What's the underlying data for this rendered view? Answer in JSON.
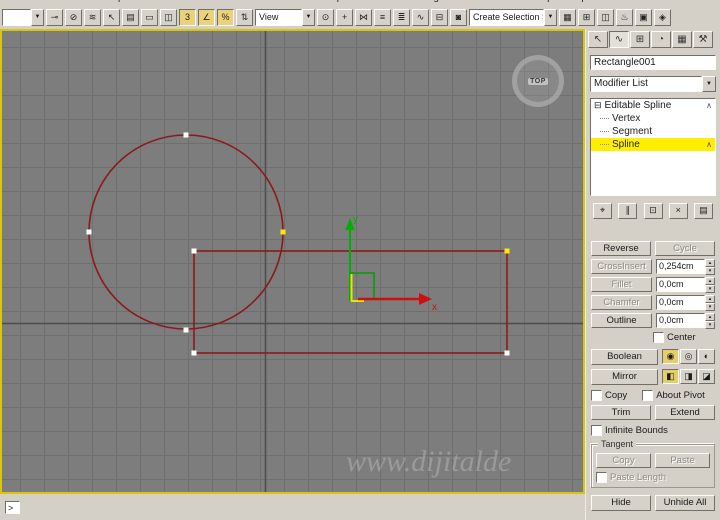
{
  "colors": {
    "ui_gray": "#d4d0c8",
    "viewport_bg": "#7d7d7d",
    "active_viewport_border": "#d8c60a",
    "spline_red": "#8b1a1a",
    "selected_vertex_yellow": "#ffe800",
    "vertex_white": "#ffffff",
    "axis_y_green": "#00b000",
    "axis_x_red": "#cc1010",
    "stack_highlight_yellow": "#ffee00"
  },
  "icons": {
    "combo_arrow": "▼",
    "minus_box": "⊟",
    "chevron": "∧",
    "spin_up": "▴",
    "spin_down": "▾"
  },
  "menu": {
    "items": [
      "File",
      "Edit",
      "Tools",
      "Group",
      "Views",
      "Create",
      "Modifiers",
      "Animation",
      "Graph Editors",
      "Rendering",
      "Customize",
      "MAXScript",
      "Help"
    ]
  },
  "toolbar": {
    "left_combo_value": "",
    "view_combo_value": "View",
    "selection_combo_value": "Create Selection Se",
    "group1": [
      {
        "n": "select-and-link-icon",
        "g": "⊸"
      },
      {
        "n": "unlink-selection-icon",
        "g": "⊘"
      },
      {
        "n": "bind-to-spacewarp-icon",
        "g": "≋"
      },
      {
        "n": "select-object-icon",
        "g": "↖"
      },
      {
        "n": "select-by-name-icon",
        "g": "▤"
      },
      {
        "n": "select-region-icon",
        "g": "▭"
      },
      {
        "n": "window-crossing-icon",
        "g": "◫"
      },
      {
        "n": "snap-toggle-icon",
        "g": "3",
        "cls": "snap"
      },
      {
        "n": "angle-snap-icon",
        "g": "∠",
        "cls": "snap"
      },
      {
        "n": "percent-snap-icon",
        "g": "%",
        "cls": "snap"
      },
      {
        "n": "spinner-snap-icon",
        "g": "⇅"
      }
    ],
    "group2": [
      {
        "n": "use-center-icon",
        "g": "⊙"
      },
      {
        "n": "select-manipulate-icon",
        "g": "+"
      },
      {
        "n": "mirror-tool-icon",
        "g": "⋈"
      },
      {
        "n": "align-tool-icon",
        "g": "≡"
      },
      {
        "n": "layer-manager-icon",
        "g": "≣"
      },
      {
        "n": "curve-editor-icon",
        "g": "∿"
      },
      {
        "n": "schematic-view-icon",
        "g": "⊟"
      },
      {
        "n": "material-editor-icon",
        "g": "◙"
      }
    ],
    "group3": [
      {
        "n": "named-selections-icon",
        "g": "▦"
      },
      {
        "n": "array-tool-icon",
        "g": "⊞"
      },
      {
        "n": "snapshot-icon",
        "g": "◫"
      },
      {
        "n": "render-setup-icon",
        "g": "♨"
      },
      {
        "n": "render-frame-icon",
        "g": "▣"
      },
      {
        "n": "quick-render-icon",
        "g": "◈"
      }
    ]
  },
  "viewport": {
    "view_label": "TOP",
    "axis_x": "x",
    "axis_y": "y",
    "watermark": "www.dijitalde"
  },
  "statusbar": {
    "prompt": ">"
  },
  "panel": {
    "tabs": [
      {
        "n": "tab-create",
        "g": "↖"
      },
      {
        "n": "tab-modify",
        "g": "∿",
        "cls": "active"
      },
      {
        "n": "tab-hierarchy",
        "g": "⊞"
      },
      {
        "n": "tab-motion",
        "g": "◔"
      },
      {
        "n": "tab-display",
        "g": "▦"
      },
      {
        "n": "tab-utilities",
        "g": "⚒"
      }
    ],
    "object_name": "Rectangle001",
    "modifier_list_label": "Modifier List",
    "stack": {
      "root": "Editable Spline",
      "children": [
        {
          "label": "Vertex",
          "name": "stack-item-vertex"
        },
        {
          "label": "Segment",
          "name": "stack-item-segment"
        },
        {
          "label": "Spline",
          "name": "stack-item-spline",
          "cls": "sel",
          "chev": "∧"
        }
      ]
    },
    "stack_tools": [
      {
        "n": "pin-stack-icon",
        "g": "⌖"
      },
      {
        "n": "show-end-result-icon",
        "g": "∥"
      },
      {
        "n": "make-unique-icon",
        "g": "⊡"
      },
      {
        "n": "remove-modifier-icon",
        "g": "×"
      },
      {
        "n": "configure-modifier-sets-icon",
        "g": "▤"
      }
    ],
    "rollout": {
      "reverse": "Reverse",
      "cycle": "Cycle",
      "crossinsert": "CrossInsert",
      "crossinsert_value": "0,254cm",
      "fillet": "Fillet",
      "fillet_value": "0,0cm",
      "chamfer": "Chamfer",
      "chamfer_value": "0,0cm",
      "outline": "Outline",
      "outline_value": "0,0cm",
      "center": "Center",
      "boolean": "Boolean",
      "boolean_icons": [
        {
          "n": "boolean-union-icon",
          "g": "◉",
          "cls": "on"
        },
        {
          "n": "boolean-subtract-icon",
          "g": "◎"
        },
        {
          "n": "boolean-intersect-icon",
          "g": "◐"
        }
      ],
      "mirror": "Mirror",
      "mirror_icons": [
        {
          "n": "mirror-horizontal-icon",
          "g": "◧",
          "cls": "on"
        },
        {
          "n": "mirror-vertical-icon",
          "g": "◨"
        },
        {
          "n": "mirror-both-icon",
          "g": "◪"
        }
      ],
      "copy": "Copy",
      "about_pivot": "About Pivot",
      "trim": "Trim",
      "extend": "Extend",
      "infinite_bounds": "Infinite Bounds",
      "tangent": "Tangent",
      "tangent_copy": "Copy",
      "tangent_paste": "Paste",
      "paste_length": "Paste Length",
      "hide": "Hide",
      "unhide_all": "Unhide All"
    }
  }
}
